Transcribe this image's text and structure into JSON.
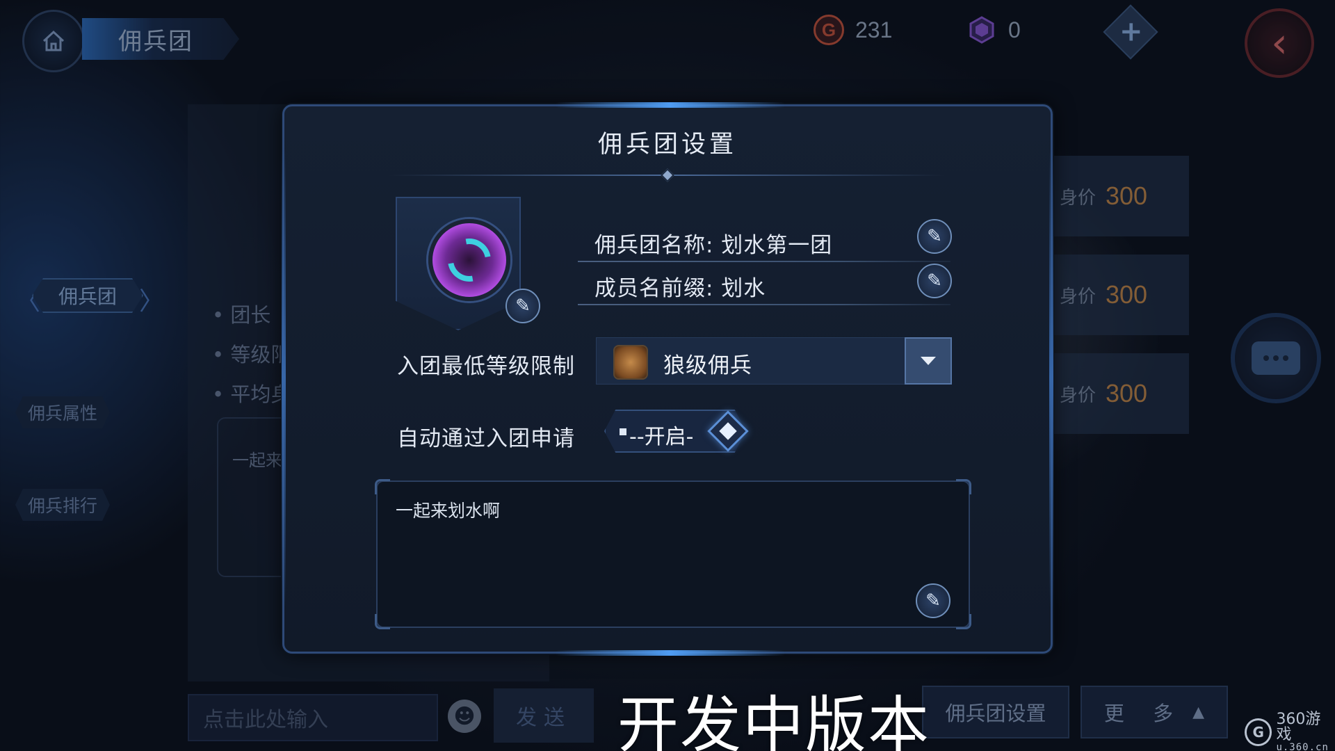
{
  "header": {
    "title": "佣兵团",
    "home_icon": "home-icon",
    "back_icon": "back-arrow-icon"
  },
  "currency": {
    "gold": {
      "icon": "gold-coin-icon",
      "symbol": "G",
      "value": "231",
      "color": "#c9553d"
    },
    "gem": {
      "icon": "purple-cube-icon",
      "value": "0",
      "color": "#8a5ad8"
    },
    "add_icon": "plus-icon",
    "add_symbol": "+"
  },
  "left_nav": {
    "active": "佣兵团",
    "items": [
      "佣兵属性",
      "佣兵排行"
    ],
    "chev_left": "〈",
    "chev_right": "〉"
  },
  "background_panel": {
    "bullets": [
      "• 团长",
      "• 等级限",
      "• 平均身"
    ],
    "motto_preview": "一起来"
  },
  "price_cards": [
    {
      "label": "身价",
      "value": "300"
    },
    {
      "label": "身价",
      "value": "300"
    },
    {
      "label": "身价",
      "value": "300"
    }
  ],
  "modal": {
    "title": "佣兵团设置",
    "name_field": "佣兵团名称: 划水第一团",
    "prefix_field": "成员名前缀: 划水",
    "min_level_label": "入团最低等级限制",
    "min_level_value": "狼级佣兵",
    "min_level_icon": "wolf-rank-icon",
    "auto_approve_label": "自动通过入团申请",
    "auto_approve_state": "--开启-",
    "description": "一起来划水啊",
    "emblem_icon": "guild-emblem-icon",
    "pen_symbol": "✎"
  },
  "bottom": {
    "input_placeholder": "点击此处输入",
    "send_label": "发送",
    "emoji_symbol": "☻",
    "settings_label": "佣兵团设置",
    "more_label": "更 多",
    "more_arrow": "▲"
  },
  "overlay": {
    "watermark": "开发中版本",
    "brand_main": "360游戏",
    "brand_sub": "u.360.cn",
    "brand_logo": "G"
  },
  "back_symbol": "‹"
}
